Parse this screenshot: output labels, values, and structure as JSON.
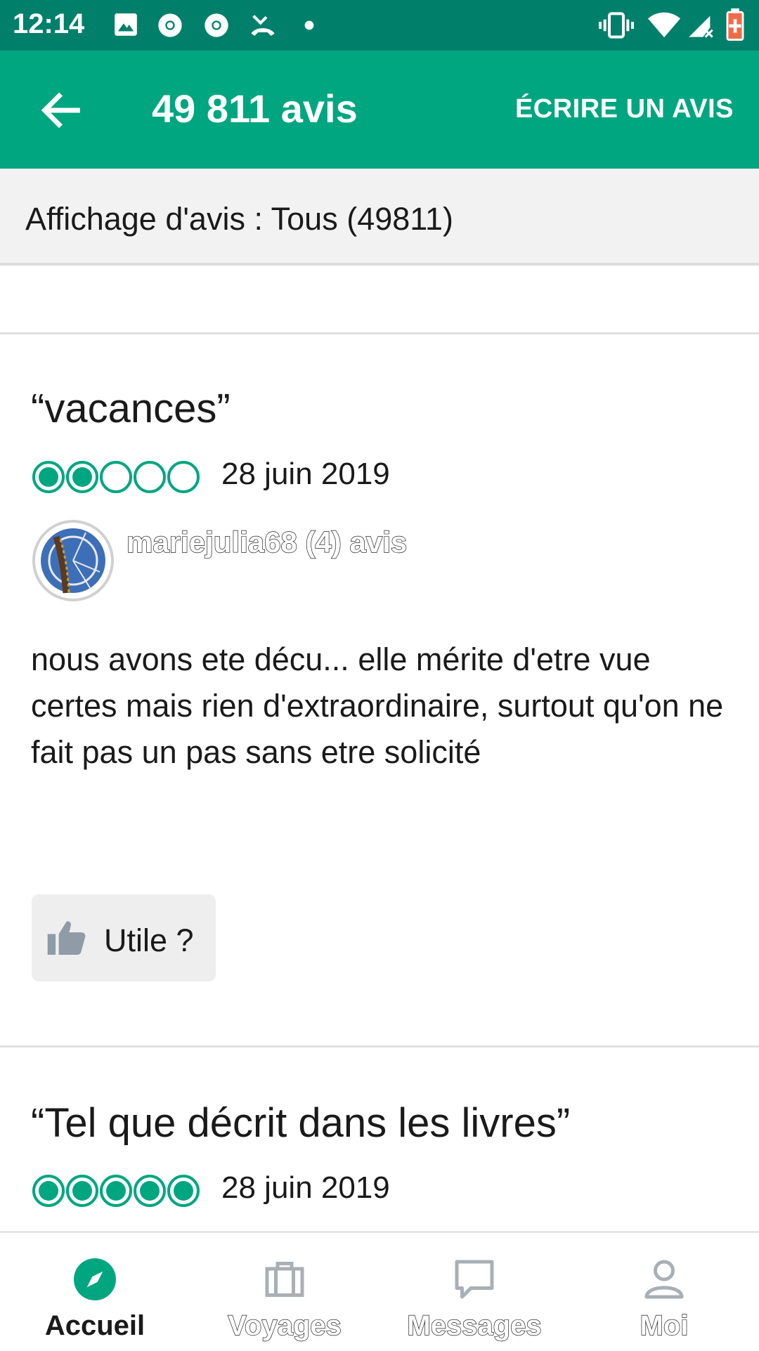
{
  "status_bar": {
    "time": "12:14",
    "icons": [
      "image-icon",
      "chrome-icon",
      "chrome-icon",
      "missed-call-icon",
      "dot-icon",
      "vibrate-icon",
      "wifi-icon",
      "signal-icon",
      "battery-icon"
    ]
  },
  "app_bar": {
    "title": "49 811 avis",
    "write_review": "ÉCRIRE UN AVIS"
  },
  "filter": {
    "label": "Affichage d'avis : Tous (49811)"
  },
  "colors": {
    "brand": "#00a680",
    "status_bar": "#00806b"
  },
  "reviews": [
    {
      "title": "“vacances”",
      "rating": 2,
      "rating_max": 5,
      "date": "28 juin 2019",
      "author": "mariejulia68 (4) avis",
      "text": "nous avons ete décu... elle mérite d'etre vue certes mais rien d'extraordinaire, surtout qu'on ne fait pas un pas sans etre solicité",
      "helpful_label": "Utile ?"
    },
    {
      "title": "“Tel que décrit dans les livres”",
      "rating": 5,
      "rating_max": 5,
      "date": "28 juin 2019"
    }
  ],
  "bottom_nav": [
    {
      "label": "Accueil",
      "icon": "compass-icon",
      "active": true
    },
    {
      "label": "Voyages",
      "icon": "suitcase-icon",
      "active": false
    },
    {
      "label": "Messages",
      "icon": "message-icon",
      "active": false
    },
    {
      "label": "Moi",
      "icon": "person-icon",
      "active": false
    }
  ]
}
